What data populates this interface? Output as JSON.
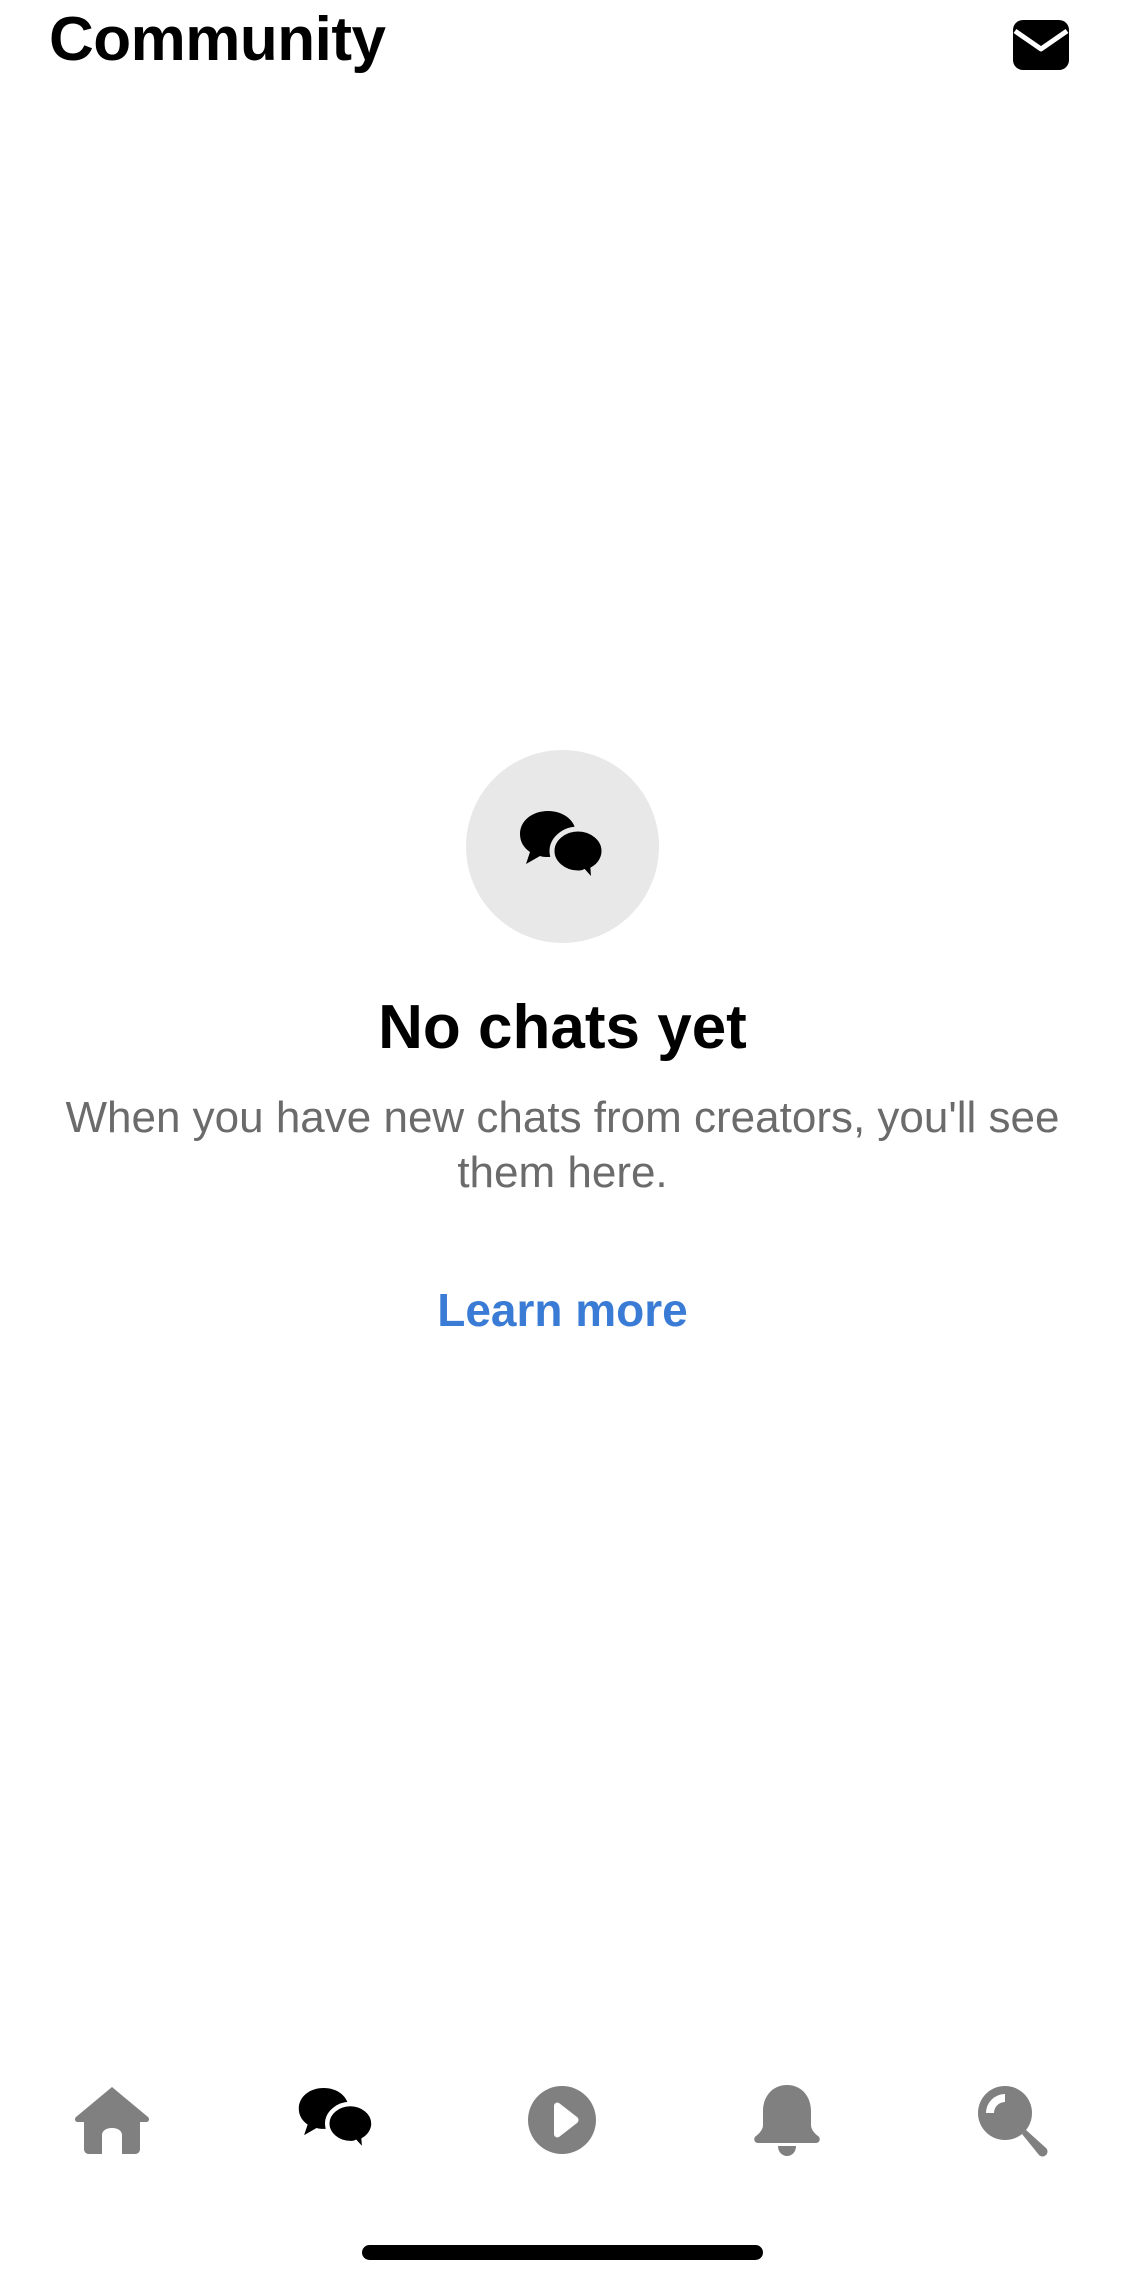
{
  "header": {
    "title": "Community",
    "inbox_icon": "envelope-icon"
  },
  "empty_state": {
    "icon": "chat-bubbles-icon",
    "title": "No chats yet",
    "description": "When you have new chats from creators, you'll see them here.",
    "link_label": "Learn more",
    "link_color": "#3a7bd5"
  },
  "tabbar": {
    "active_color": "#000000",
    "inactive_color": "#808080",
    "tabs": [
      {
        "icon": "home-icon",
        "active": false
      },
      {
        "icon": "chat-bubbles-icon",
        "active": true
      },
      {
        "icon": "play-icon",
        "active": false
      },
      {
        "icon": "bell-icon",
        "active": false
      },
      {
        "icon": "search-icon",
        "active": false
      }
    ]
  }
}
